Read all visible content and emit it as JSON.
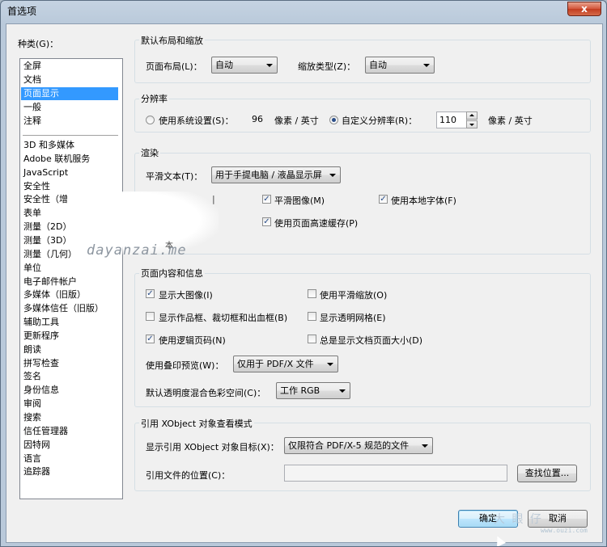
{
  "window": {
    "title": "首选项",
    "close": "x"
  },
  "categories": {
    "label": "种类(G)：",
    "group1": [
      "全屏",
      "文档",
      "页面显示",
      "一般",
      "注释"
    ],
    "selected": "页面显示",
    "group2": [
      "3D 和多媒体",
      "Adobe 联机服务",
      "JavaScript",
      "安全性",
      "安全性（增",
      "表单",
      "测量（2D）",
      "测量（3D）",
      "测量（几何）",
      "单位",
      "电子邮件帐户",
      "多媒体（旧版）",
      "多媒体信任（旧版）",
      "辅助工具",
      "更新程序",
      "朗读",
      "拼写检查",
      "签名",
      "身份信息",
      "审阅",
      "搜索",
      "信任管理器",
      "因特网",
      "语言",
      "追踪器"
    ]
  },
  "layout": {
    "title": "默认布局和缩放",
    "page_layout_label": "页面布局(L)：",
    "page_layout_value": "自动",
    "zoom_label": "缩放类型(Z)：",
    "zoom_value": "自动"
  },
  "resolution": {
    "title": "分辨率",
    "system_label": "使用系统设置(S)：",
    "system_value": "96",
    "system_unit": "像素 / 英寸",
    "custom_label": "自定义分辨率(R)：",
    "custom_value": "110",
    "custom_unit": "像素 / 英寸"
  },
  "rendering": {
    "title": "渲染",
    "smooth_text_label": "平滑文本(T)：",
    "smooth_text_value": "用于手提电脑 / 液晶显示屏",
    "smooth_images": "平滑图像(M)",
    "local_fonts": "使用本地字体(F)",
    "page_cache": "使用页面高速缓存(P)",
    "stray_glyph1": "|",
    "stray_glyph2": "本"
  },
  "content": {
    "title": "页面内容和信息",
    "show_large_images": "显示大图像(I)",
    "smooth_zoom": "使用平滑缩放(O)",
    "show_boxes": "显示作品框、裁切框和出血框(B)",
    "show_transparency_grid": "显示透明网格(E)",
    "logical_page_numbers": "使用逻辑页码(N)",
    "always_show_page_size": "总是显示文档页面大小(D)",
    "overprint_label": "使用叠印预览(W)：",
    "overprint_value": "仅用于 PDF/X 文件",
    "blend_label": "默认透明度混合色彩空间(C)：",
    "blend_value": "工作 RGB"
  },
  "xobject": {
    "title": "引用 XObject 对象查看模式",
    "target_label": "显示引用 XObject 对象目标(X)：",
    "target_value": "仅限符合 PDF/X-5 规范的文件",
    "location_label": "引用文件的位置(C)：",
    "location_value": "",
    "browse": "查找位置..."
  },
  "buttons": {
    "ok": "确定",
    "cancel": "取消"
  },
  "watermark": {
    "main": "dayanzai.me",
    "corner": "大 眼 仔",
    "corner_url": "www.ouzi.com"
  }
}
